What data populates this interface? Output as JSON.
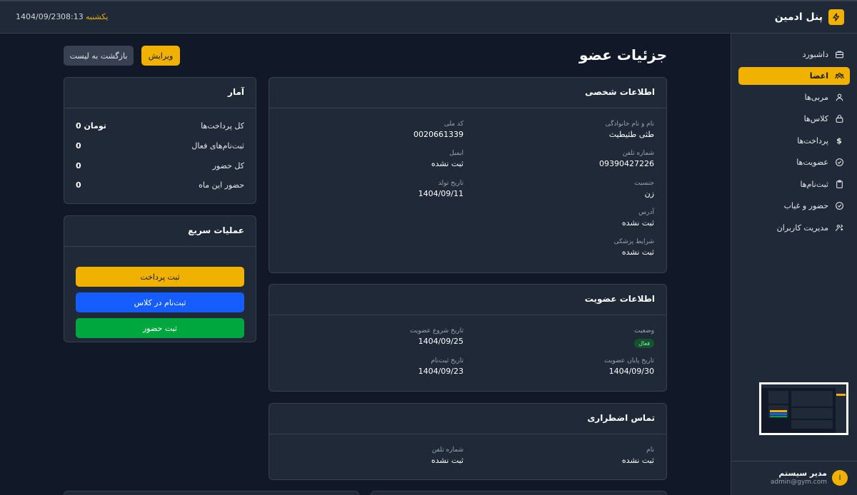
{
  "topbar": {
    "date": "1404/09/23",
    "time": "08:13",
    "day": "یکشنبه",
    "brand_title": "پنل ادمین",
    "brand_icon": "bolt-icon"
  },
  "sidebar": {
    "items": [
      {
        "label": "داشبورد",
        "icon": "dashboard-icon"
      },
      {
        "label": "اعضا",
        "icon": "users-icon",
        "active": true
      },
      {
        "label": "مربی‌ها",
        "icon": "user-icon"
      },
      {
        "label": "کلاس‌ها",
        "icon": "lock-icon"
      },
      {
        "label": "پرداخت‌ها",
        "icon": "dollar-icon"
      },
      {
        "label": "عضویت‌ها",
        "icon": "check-circle-icon"
      },
      {
        "label": "ثبت‌نام‌ها",
        "icon": "clipboard-icon"
      },
      {
        "label": "حضور و غیاب",
        "icon": "check-circle-icon"
      },
      {
        "label": "مدیریت کاربران",
        "icon": "user-gear-icon"
      }
    ],
    "user": {
      "initial": "ا",
      "name": "مدیر سیستم",
      "email": "admin@gym.com"
    }
  },
  "page": {
    "title": "جزئیات عضو",
    "edit_label": "ویرایش",
    "back_label": "بازگشت به لیست"
  },
  "personal": {
    "title": "اطلاعات شخصی",
    "full_name_label": "نام و نام خانوادگی",
    "full_name": "طثی طثیطیث",
    "national_id_label": "کد ملی",
    "national_id": "0020661339",
    "phone_label": "شماره تلفن",
    "phone": "09390427226",
    "email_label": "ایمیل",
    "email": "ثبت نشده",
    "gender_label": "جنسیت",
    "gender": "زن",
    "birth_label": "تاریخ تولد",
    "birth": "1404/09/11",
    "address_label": "آدرس",
    "address": "ثبت نشده",
    "medical_label": "شرایط پزشکی",
    "medical": "ثبت نشده"
  },
  "membership": {
    "title": "اطلاعات عضویت",
    "status_label": "وضعیت",
    "status": "فعال",
    "start_label": "تاریخ شروع عضویت",
    "start": "1404/09/25",
    "end_label": "تاریخ پایان عضویت",
    "end": "1404/09/30",
    "registered_label": "تاریخ ثبت‌نام",
    "registered": "1404/09/23"
  },
  "emergency": {
    "title": "تماس اضطراری",
    "name_label": "نام",
    "name": "ثبت نشده",
    "phone_label": "شماره تلفن",
    "phone": "ثبت نشده"
  },
  "stats": {
    "title": "آمار",
    "rows": [
      {
        "label": "کل پرداخت‌ها",
        "value": "0 تومان"
      },
      {
        "label": "ثبت‌نام‌های فعال",
        "value": "0"
      },
      {
        "label": "کل حضور",
        "value": "0"
      },
      {
        "label": "حضور این ماه",
        "value": "0"
      }
    ]
  },
  "quick": {
    "title": "عملیات سریع",
    "pay": "ثبت پرداخت",
    "enroll": "ثبت‌نام در کلاس",
    "attendance": "ثبت حضور"
  },
  "colors": {
    "accent": "#f0b100",
    "blue": "#155dfc",
    "green": "#00a63e",
    "bg": "#111827",
    "panel": "#1f2937"
  }
}
